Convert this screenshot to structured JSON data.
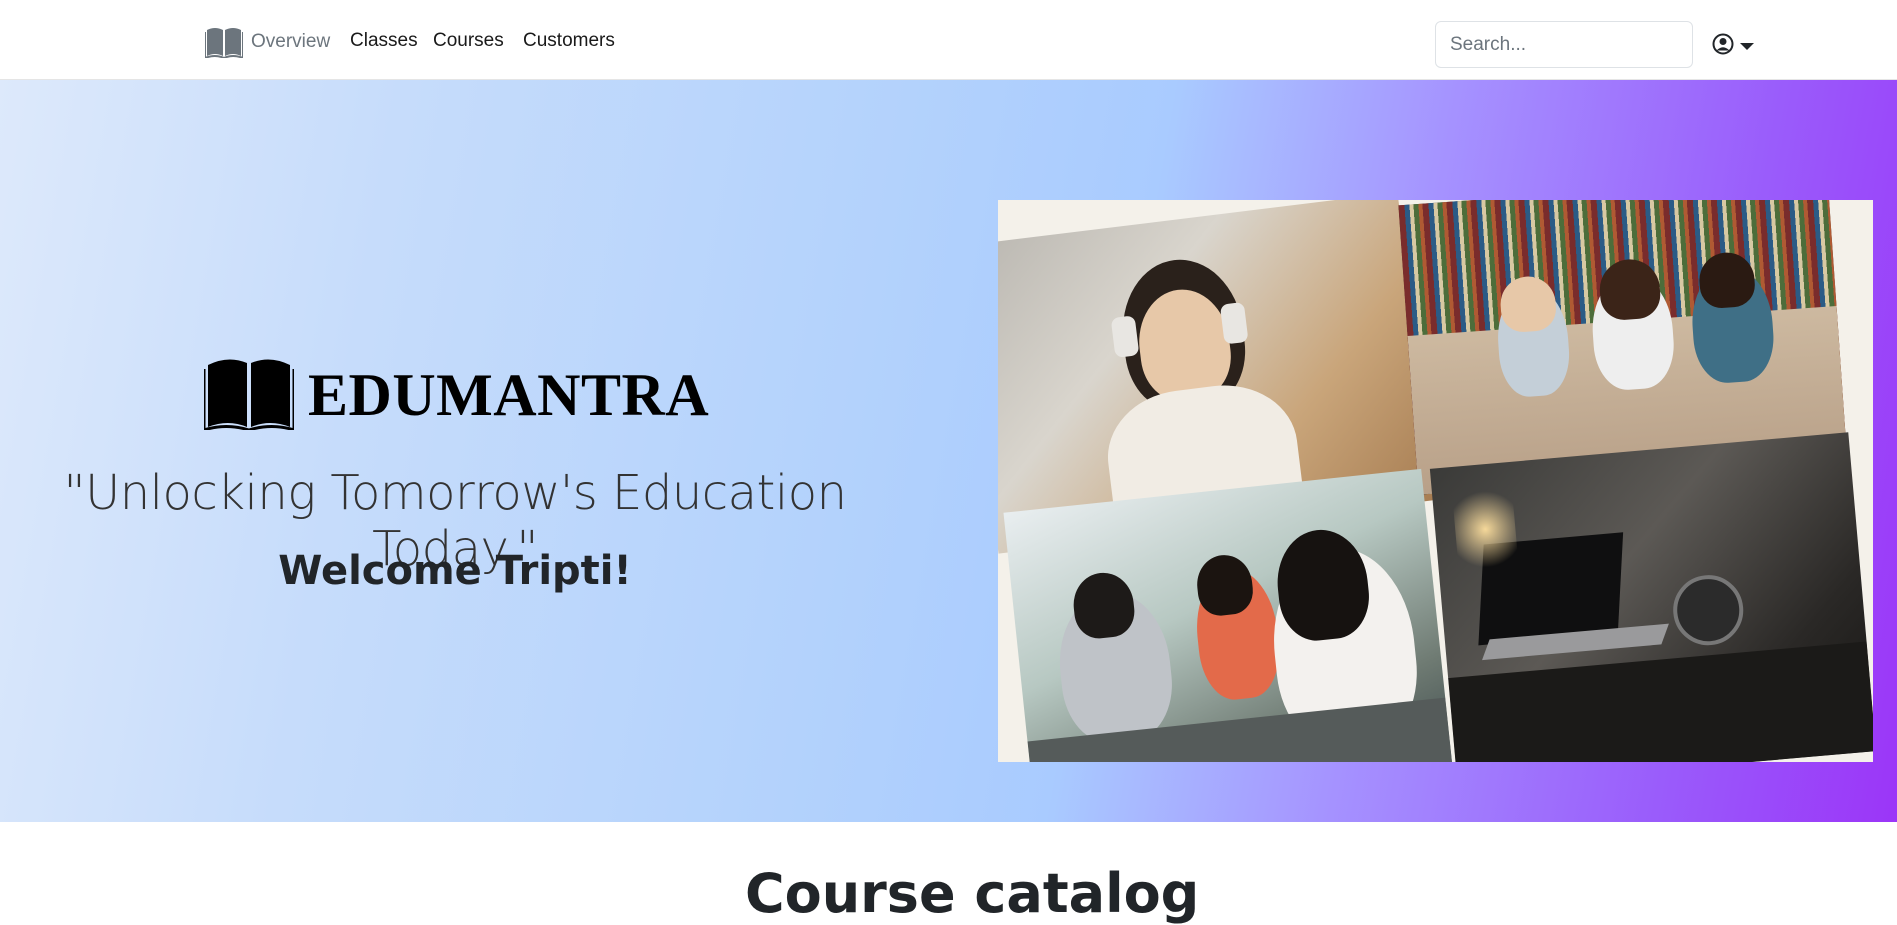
{
  "nav": {
    "brand_label": "Overview",
    "items": [
      {
        "label": "Classes"
      },
      {
        "label": "Courses"
      },
      {
        "label": "Customers"
      }
    ],
    "search": {
      "placeholder": "Search..."
    },
    "icons": {
      "brand": "book-icon",
      "user": "user-circle-icon",
      "menu": "caret-down-icon"
    }
  },
  "hero": {
    "logo_text": "EDUMANTRA",
    "tagline": "\"Unlocking Tomorrow's Education Today.\"",
    "welcome": "Welcome Tripti!",
    "gradient_colors": [
      "#dde9fb",
      "#a9cbff",
      "#9b35f8"
    ]
  },
  "section": {
    "title": "Course catalog"
  }
}
